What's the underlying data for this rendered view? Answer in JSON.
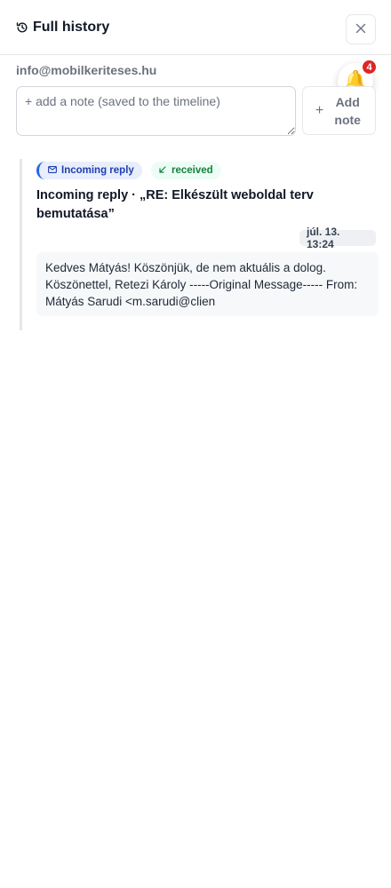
{
  "header": {
    "title": "Full history",
    "history_icon": "history-icon",
    "close_icon": "close-icon"
  },
  "contact": {
    "email": "info@mobilkeriteses.hu"
  },
  "notifications": {
    "icon": "bell-icon",
    "glyph": "🔔",
    "count": "4"
  },
  "note": {
    "placeholder": "+ add a note (saved to the timeline)",
    "value": "",
    "add_button_label": "Add note",
    "add_icon": "plus-icon",
    "add_glyph": "+"
  },
  "timeline": {
    "entries": [
      {
        "type_badge": "Incoming reply",
        "type_icon": "mail-icon",
        "status_badge": "received",
        "status_icon": "arrow-down-left-icon",
        "title": "Incoming reply · „RE: Elkészült weboldal terv bemutatása”",
        "timestamp": "júl. 13. 13:24",
        "body": "Kedves Mátyás! Köszönjük, de nem aktuális a dolog. Köszönettel, Retezi Károly -----Original Message----- From: Mátyás Sarudi <m.sarudi@clien"
      }
    ]
  },
  "colors": {
    "accent": "#2563eb",
    "received": "#15803d",
    "badge_red": "#dc2626",
    "border": "#e5e7eb"
  }
}
